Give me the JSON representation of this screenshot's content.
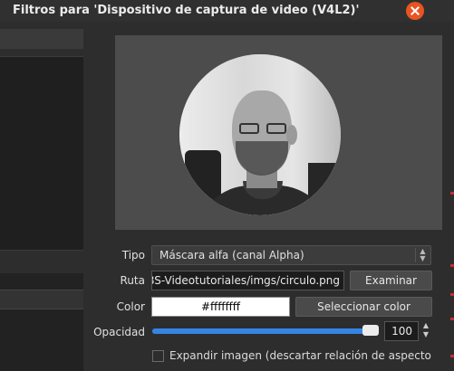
{
  "window": {
    "title": "Filtros para 'Dispositivo de captura de video (V4L2)'"
  },
  "properties": {
    "tipo_label": "Tipo",
    "tipo_value": "Máscara alfa (canal Alpha)",
    "ruta_label": "Ruta",
    "ruta_value": "ABS-Videotutoriales/imgs/circulo.png",
    "examinar_label": "Examinar",
    "color_label": "Color",
    "color_value": "#ffffffff",
    "seleccionar_color_label": "Seleccionar color",
    "opacidad_label": "Opacidad",
    "opacidad_value": "100",
    "opacidad_percent": 100,
    "expandir_label": "Expandir imagen (descartar relación de aspecto de imagen)",
    "expandir_checked": false
  },
  "colors": {
    "accent": "#3584e4",
    "close": "#e95420"
  }
}
